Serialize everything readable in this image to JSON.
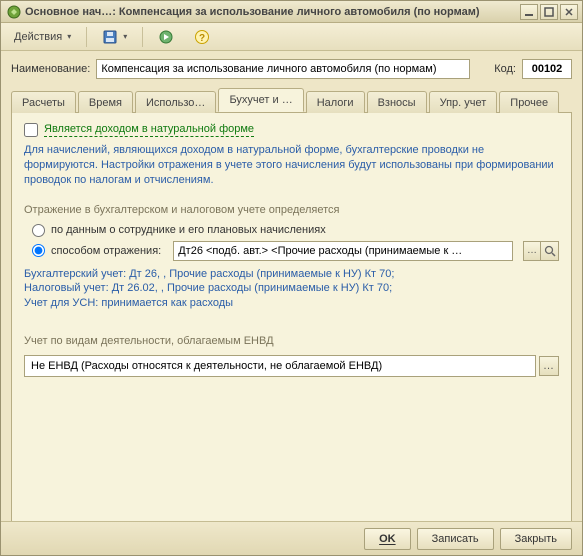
{
  "window": {
    "title": "Основное нач…: Компенсация за использование личного автомобиля (по нормам)"
  },
  "toolbar": {
    "actions_label": "Действия"
  },
  "fields": {
    "name_label": "Наименование:",
    "name_value": "Компенсация за использование личного автомобиля (по нормам)",
    "code_label": "Код:",
    "code_value": "00102"
  },
  "tabs": [
    {
      "label": "Расчеты"
    },
    {
      "label": "Время"
    },
    {
      "label": "Использо…"
    },
    {
      "label": "Бухучет и …"
    },
    {
      "label": "Налоги"
    },
    {
      "label": "Взносы"
    },
    {
      "label": "Упр. учет"
    },
    {
      "label": "Прочее"
    }
  ],
  "page": {
    "natural_income_label": "Является доходом в натуральной форме",
    "natural_income_hint": "Для начислений, являющихся доходом в натуральной форме, бухгалтерские проводки не формируются. Настройки отражения в учете этого начисления будут использованы при формировании проводок по налогам и отчислениям.",
    "reflection_title": "Отражение в бухгалтерском и налоговом учете определяется",
    "radio_by_employee": "по данным о сотруднике и его плановых начислениях",
    "radio_by_method": "способом отражения:",
    "method_value": "Дт26 <подб. авт.> <Прочие расходы (принимаемые к …",
    "info_line1": "Бухгалтерский учет: Дт 26, , Прочие расходы (принимаемые к НУ) Кт 70;",
    "info_line2": "Налоговый учет: Дт 26.02, , Прочие расходы (принимаемые к НУ) Кт 70;",
    "info_line3": "Учет для УСН: принимается как расходы",
    "enbd_title": "Учет по видам деятельности, облагаемым ЕНВД",
    "enbd_value": "Не ЕНВД (Расходы относятся к деятельности, не облагаемой ЕНВД)"
  },
  "buttons": {
    "ok": "OK",
    "save": "Записать",
    "close": "Закрыть"
  }
}
